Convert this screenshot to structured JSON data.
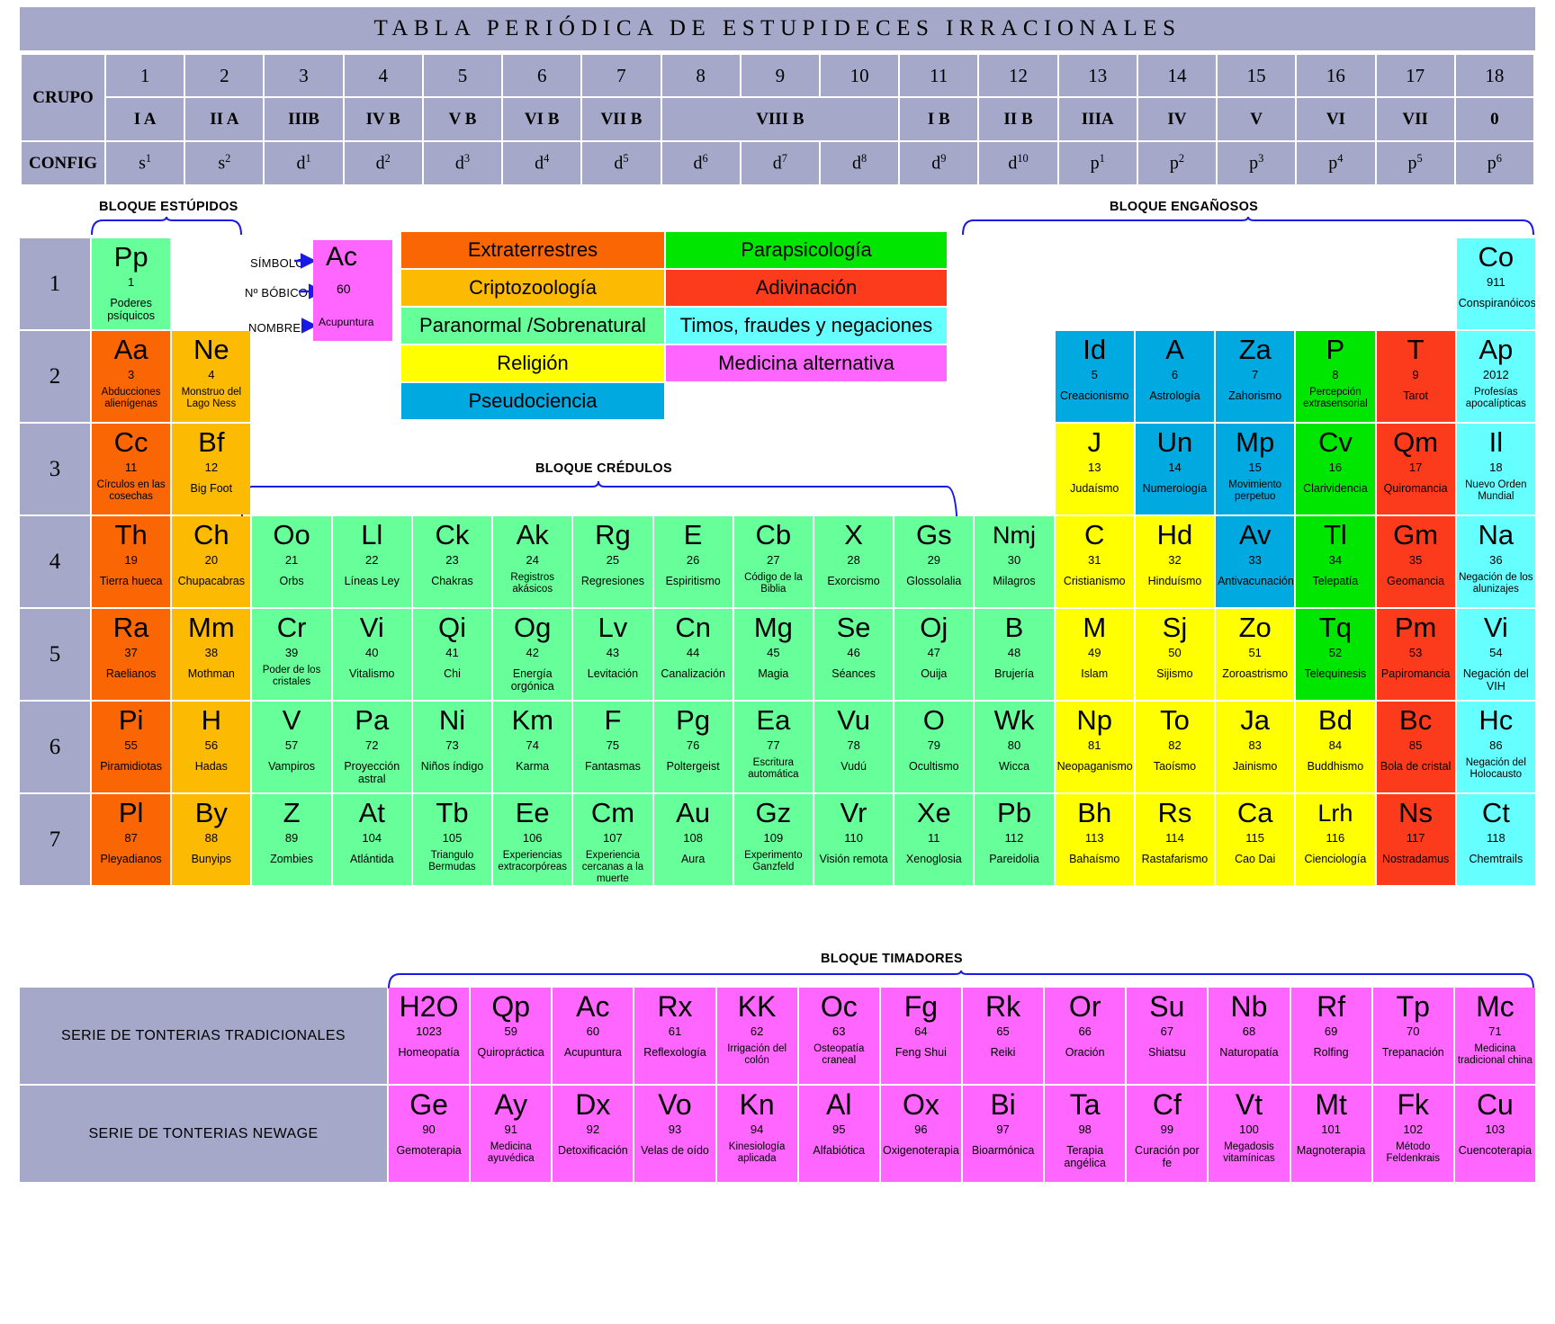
{
  "title": "TABLA  PERIÓDICA  DE  ESTUPIDECES  IRRACIONALES",
  "header": {
    "group_label": "CRUPO",
    "config_label": "CONFIG",
    "numbers": [
      "1",
      "2",
      "3",
      "4",
      "5",
      "6",
      "7",
      "8",
      "9",
      "10",
      "11",
      "12",
      "13",
      "14",
      "15",
      "16",
      "17",
      "18"
    ],
    "roman": [
      "I A",
      "II A",
      "IIIB",
      "IV B",
      "V B",
      "VI B",
      "VII B",
      "VIII B",
      "I B",
      "II B",
      "IIIA",
      "IV",
      "V",
      "VI",
      "VII",
      "0"
    ],
    "config_base": [
      "s",
      "s",
      "d",
      "d",
      "d",
      "d",
      "d",
      "d",
      "d",
      "d",
      "d",
      "d",
      "p",
      "p",
      "p",
      "p",
      "p",
      "p"
    ],
    "config_sup": [
      "1",
      "2",
      "1",
      "2",
      "3",
      "4",
      "5",
      "6",
      "7",
      "8",
      "9",
      "10",
      "1",
      "2",
      "3",
      "4",
      "5",
      "6"
    ]
  },
  "key": {
    "symbol_label": "SÍMBOLO",
    "number_label": "Nº BÓBICO",
    "name_label": "NOMBRE",
    "symbol": "Ac",
    "number": "60",
    "name": "Acupuntura",
    "color": "#ff66ff"
  },
  "legend": [
    {
      "label": "Extraterrestres",
      "color": "#f96603"
    },
    {
      "label": "Parapsicología",
      "color": "#00e600"
    },
    {
      "label": "Criptozoología",
      "color": "#fcba03"
    },
    {
      "label": "Adivinación",
      "color": "#fc3b1c"
    },
    {
      "label": "Paranormal /Sobrenatural",
      "color": "#66ff99"
    },
    {
      "label": "Timos, fraudes y negaciones",
      "color": "#66ffff"
    },
    {
      "label": "Religión",
      "color": "#ffff00"
    },
    {
      "label": "Medicina alternativa",
      "color": "#ff66ff"
    },
    {
      "label": "Pseudociencia",
      "color": "#00a9e0"
    }
  ],
  "blocks": {
    "estupidos": "BLOQUE ESTÚPIDOS",
    "enganosos": "BLOQUE ENGAÑOSOS",
    "credulos": "BLOQUE CRÉDULOS",
    "timadores": "BLOQUE TIMADORES"
  },
  "period_labels": [
    "1",
    "2",
    "3",
    "4",
    "5",
    "6",
    "7"
  ],
  "series_labels": {
    "tradicionales": "SERIE DE TONTERIAS TRADICIONALES",
    "newage": "SERIE DE TONTERIAS NEWAGE"
  },
  "rows": [
    [
      {
        "sym": "Pp",
        "num": "1",
        "name": "Poderes psíquicos",
        "color": "#66ff99"
      },
      null,
      null,
      null,
      null,
      null,
      null,
      null,
      null,
      null,
      null,
      null,
      null,
      null,
      null,
      null,
      null,
      {
        "sym": "Co",
        "num": "911",
        "name": "Conspiranóicos",
        "color": "#66ffff"
      }
    ],
    [
      {
        "sym": "Aa",
        "num": "3",
        "name": "Abducciones alienígenas",
        "color": "#f96603"
      },
      {
        "sym": "Ne",
        "num": "4",
        "name": "Monstruo del Lago Ness",
        "color": "#fcba03"
      },
      null,
      null,
      null,
      null,
      null,
      null,
      null,
      null,
      null,
      null,
      {
        "sym": "Id",
        "num": "5",
        "name": "Creacionismo",
        "color": "#00a9e0"
      },
      {
        "sym": "A",
        "num": "6",
        "name": "Astrología",
        "color": "#00a9e0"
      },
      {
        "sym": "Za",
        "num": "7",
        "name": "Zahorismo",
        "color": "#00a9e0"
      },
      {
        "sym": "P",
        "num": "8",
        "name": "Percepción extrasensorial",
        "color": "#00e600"
      },
      {
        "sym": "T",
        "num": "9",
        "name": "Tarot",
        "color": "#fc3b1c"
      },
      {
        "sym": "Ap",
        "num": "2012",
        "name": "Profesías apocalípticas",
        "color": "#66ffff"
      }
    ],
    [
      {
        "sym": "Cc",
        "num": "11",
        "name": "Círculos en las cosechas",
        "color": "#f96603"
      },
      {
        "sym": "Bf",
        "num": "12",
        "name": "Big Foot",
        "color": "#fcba03"
      },
      null,
      null,
      null,
      null,
      null,
      null,
      null,
      null,
      null,
      null,
      {
        "sym": "J",
        "num": "13",
        "name": "Judaísmo",
        "color": "#ffff00"
      },
      {
        "sym": "Un",
        "num": "14",
        "name": "Numerología",
        "color": "#00a9e0"
      },
      {
        "sym": "Mp",
        "num": "15",
        "name": "Movimiento perpetuo",
        "color": "#00a9e0"
      },
      {
        "sym": "Cv",
        "num": "16",
        "name": "Clarividencia",
        "color": "#00e600"
      },
      {
        "sym": "Qm",
        "num": "17",
        "name": "Quiromancia",
        "color": "#fc3b1c"
      },
      {
        "sym": "Il",
        "num": "18",
        "name": "Nuevo Orden Mundial",
        "color": "#66ffff"
      }
    ],
    [
      {
        "sym": "Th",
        "num": "19",
        "name": "Tierra hueca",
        "color": "#f96603"
      },
      {
        "sym": "Ch",
        "num": "20",
        "name": "Chupacabras",
        "color": "#fcba03"
      },
      {
        "sym": "Oo",
        "num": "21",
        "name": "Orbs",
        "color": "#66ff99"
      },
      {
        "sym": "Ll",
        "num": "22",
        "name": "Líneas Ley",
        "color": "#66ff99"
      },
      {
        "sym": "Ck",
        "num": "23",
        "name": "Chakras",
        "color": "#66ff99"
      },
      {
        "sym": "Ak",
        "num": "24",
        "name": "Registros akásicos",
        "color": "#66ff99"
      },
      {
        "sym": "Rg",
        "num": "25",
        "name": "Regresiones",
        "color": "#66ff99"
      },
      {
        "sym": "E",
        "num": "26",
        "name": "Espiritismo",
        "color": "#66ff99"
      },
      {
        "sym": "Cb",
        "num": "27",
        "name": "Código de la Biblia",
        "color": "#66ff99"
      },
      {
        "sym": "X",
        "num": "28",
        "name": "Exorcismo",
        "color": "#66ff99"
      },
      {
        "sym": "Gs",
        "num": "29",
        "name": "Glossolalia",
        "color": "#66ff99"
      },
      {
        "sym": "Nmj",
        "num": "30",
        "name": "Milagros",
        "color": "#66ff99"
      },
      {
        "sym": "C",
        "num": "31",
        "name": "Cristianismo",
        "color": "#ffff00"
      },
      {
        "sym": "Hd",
        "num": "32",
        "name": "Hinduísmo",
        "color": "#ffff00"
      },
      {
        "sym": "Av",
        "num": "33",
        "name": "Antivacunación",
        "color": "#00a9e0"
      },
      {
        "sym": "Tl",
        "num": "34",
        "name": "Telepatía",
        "color": "#00e600"
      },
      {
        "sym": "Gm",
        "num": "35",
        "name": "Geomancia",
        "color": "#fc3b1c"
      },
      {
        "sym": "Na",
        "num": "36",
        "name": "Negación de los alunizajes",
        "color": "#66ffff"
      }
    ],
    [
      {
        "sym": "Ra",
        "num": "37",
        "name": "Raelianos",
        "color": "#f96603"
      },
      {
        "sym": "Mm",
        "num": "38",
        "name": "Mothman",
        "color": "#fcba03"
      },
      {
        "sym": "Cr",
        "num": "39",
        "name": "Poder de los cristales",
        "color": "#66ff99"
      },
      {
        "sym": "Vi",
        "num": "40",
        "name": "Vitalismo",
        "color": "#66ff99"
      },
      {
        "sym": "Qi",
        "num": "41",
        "name": "Chi",
        "color": "#66ff99"
      },
      {
        "sym": "Og",
        "num": "42",
        "name": "Energía orgónica",
        "color": "#66ff99"
      },
      {
        "sym": "Lv",
        "num": "43",
        "name": "Levitación",
        "color": "#66ff99"
      },
      {
        "sym": "Cn",
        "num": "44",
        "name": "Canalización",
        "color": "#66ff99"
      },
      {
        "sym": "Mg",
        "num": "45",
        "name": "Magia",
        "color": "#66ff99"
      },
      {
        "sym": "Se",
        "num": "46",
        "name": "Séances",
        "color": "#66ff99"
      },
      {
        "sym": "Oj",
        "num": "47",
        "name": "Ouija",
        "color": "#66ff99"
      },
      {
        "sym": "B",
        "num": "48",
        "name": "Brujería",
        "color": "#66ff99"
      },
      {
        "sym": "M",
        "num": "49",
        "name": "Islam",
        "color": "#ffff00"
      },
      {
        "sym": "Sj",
        "num": "50",
        "name": "Sijismo",
        "color": "#ffff00"
      },
      {
        "sym": "Zo",
        "num": "51",
        "name": "Zoroastrismo",
        "color": "#ffff00"
      },
      {
        "sym": "Tq",
        "num": "52",
        "name": "Telequinesis",
        "color": "#00e600"
      },
      {
        "sym": "Pm",
        "num": "53",
        "name": "Papiromancia",
        "color": "#fc3b1c"
      },
      {
        "sym": "Vi",
        "num": "54",
        "name": "Negación del VIH",
        "color": "#66ffff"
      }
    ],
    [
      {
        "sym": "Pi",
        "num": "55",
        "name": "Piramidiotas",
        "color": "#f96603"
      },
      {
        "sym": "H",
        "num": "56",
        "name": "Hadas",
        "color": "#fcba03"
      },
      {
        "sym": "V",
        "num": "57",
        "name": "Vampiros",
        "color": "#66ff99"
      },
      {
        "sym": "Pa",
        "num": "72",
        "name": "Proyección astral",
        "color": "#66ff99"
      },
      {
        "sym": "Ni",
        "num": "73",
        "name": "Niños índigo",
        "color": "#66ff99"
      },
      {
        "sym": "Km",
        "num": "74",
        "name": "Karma",
        "color": "#66ff99"
      },
      {
        "sym": "F",
        "num": "75",
        "name": "Fantasmas",
        "color": "#66ff99"
      },
      {
        "sym": "Pg",
        "num": "76",
        "name": "Poltergeist",
        "color": "#66ff99"
      },
      {
        "sym": "Ea",
        "num": "77",
        "name": "Escritura automática",
        "color": "#66ff99"
      },
      {
        "sym": "Vu",
        "num": "78",
        "name": "Vudú",
        "color": "#66ff99"
      },
      {
        "sym": "O",
        "num": "79",
        "name": "Ocultismo",
        "color": "#66ff99"
      },
      {
        "sym": "Wk",
        "num": "80",
        "name": "Wicca",
        "color": "#66ff99"
      },
      {
        "sym": "Np",
        "num": "81",
        "name": "Neopaganismo",
        "color": "#ffff00"
      },
      {
        "sym": "To",
        "num": "82",
        "name": "Taoísmo",
        "color": "#ffff00"
      },
      {
        "sym": "Ja",
        "num": "83",
        "name": "Jainismo",
        "color": "#ffff00"
      },
      {
        "sym": "Bd",
        "num": "84",
        "name": "Buddhismo",
        "color": "#ffff00"
      },
      {
        "sym": "Bc",
        "num": "85",
        "name": "Bola de cristal",
        "color": "#fc3b1c"
      },
      {
        "sym": "Hc",
        "num": "86",
        "name": "Negación del Holocausto",
        "color": "#66ffff"
      }
    ],
    [
      {
        "sym": "Pl",
        "num": "87",
        "name": "Pleyadianos",
        "color": "#f96603"
      },
      {
        "sym": "By",
        "num": "88",
        "name": "Bunyips",
        "color": "#fcba03"
      },
      {
        "sym": "Z",
        "num": "89",
        "name": "Zombies",
        "color": "#66ff99"
      },
      {
        "sym": "At",
        "num": "104",
        "name": "Atlántida",
        "color": "#66ff99"
      },
      {
        "sym": "Tb",
        "num": "105",
        "name": "Triangulo Bermudas",
        "color": "#66ff99"
      },
      {
        "sym": "Ee",
        "num": "106",
        "name": "Experiencias extracorpóreas",
        "color": "#66ff99"
      },
      {
        "sym": "Cm",
        "num": "107",
        "name": "Experiencia cercanas a la muerte",
        "color": "#66ff99"
      },
      {
        "sym": "Au",
        "num": "108",
        "name": "Aura",
        "color": "#66ff99"
      },
      {
        "sym": "Gz",
        "num": "109",
        "name": "Experimento Ganzfeld",
        "color": "#66ff99"
      },
      {
        "sym": "Vr",
        "num": "110",
        "name": "Visión remota",
        "color": "#66ff99"
      },
      {
        "sym": "Xe",
        "num": "11",
        "name": "Xenoglosia",
        "color": "#66ff99"
      },
      {
        "sym": "Pb",
        "num": "112",
        "name": "Pareidolia",
        "color": "#66ff99"
      },
      {
        "sym": "Bh",
        "num": "113",
        "name": "Bahaísmo",
        "color": "#ffff00"
      },
      {
        "sym": "Rs",
        "num": "114",
        "name": "Rastafarismo",
        "color": "#ffff00"
      },
      {
        "sym": "Ca",
        "num": "115",
        "name": "Cao Dai",
        "color": "#ffff00"
      },
      {
        "sym": "Lrh",
        "num": "116",
        "name": "Cienciología",
        "color": "#ffff00"
      },
      {
        "sym": "Ns",
        "num": "117",
        "name": "Nostradamus",
        "color": "#fc3b1c"
      },
      {
        "sym": "Ct",
        "num": "118",
        "name": "Chemtrails",
        "color": "#66ffff"
      }
    ]
  ],
  "series": {
    "tradicionales": [
      {
        "sym": "H2O",
        "num": "1023",
        "name": "Homeopatía"
      },
      {
        "sym": "Qp",
        "num": "59",
        "name": "Quiropráctica"
      },
      {
        "sym": "Ac",
        "num": "60",
        "name": "Acupuntura"
      },
      {
        "sym": "Rx",
        "num": "61",
        "name": "Reflexología"
      },
      {
        "sym": "KK",
        "num": "62",
        "name": "Irrigación del colón"
      },
      {
        "sym": "Oc",
        "num": "63",
        "name": "Osteopatía craneal"
      },
      {
        "sym": "Fg",
        "num": "64",
        "name": "Feng Shui"
      },
      {
        "sym": "Rk",
        "num": "65",
        "name": "Reiki"
      },
      {
        "sym": "Or",
        "num": "66",
        "name": "Oración"
      },
      {
        "sym": "Su",
        "num": "67",
        "name": "Shiatsu"
      },
      {
        "sym": "Nb",
        "num": "68",
        "name": "Naturopatía"
      },
      {
        "sym": "Rf",
        "num": "69",
        "name": "Rolfing"
      },
      {
        "sym": "Tp",
        "num": "70",
        "name": "Trepanación"
      },
      {
        "sym": "Mc",
        "num": "71",
        "name": "Medicina tradicional china"
      }
    ],
    "newage": [
      {
        "sym": "Ge",
        "num": "90",
        "name": "Gemoterapia"
      },
      {
        "sym": "Ay",
        "num": "91",
        "name": "Medicina ayuvédica"
      },
      {
        "sym": "Dx",
        "num": "92",
        "name": "Detoxificación"
      },
      {
        "sym": "Vo",
        "num": "93",
        "name": "Velas de oído"
      },
      {
        "sym": "Kn",
        "num": "94",
        "name": "Kinesiología aplicada"
      },
      {
        "sym": "Al",
        "num": "95",
        "name": "Alfabiótica"
      },
      {
        "sym": "Ox",
        "num": "96",
        "name": "Oxigenoterapia"
      },
      {
        "sym": "Bi",
        "num": "97",
        "name": "Bioarmónica"
      },
      {
        "sym": "Ta",
        "num": "98",
        "name": "Terapia angélica"
      },
      {
        "sym": "Cf",
        "num": "99",
        "name": "Curación por fe"
      },
      {
        "sym": "Vt",
        "num": "100",
        "name": "Megadosis vitamínicas"
      },
      {
        "sym": "Mt",
        "num": "101",
        "name": "Magnoterapia"
      },
      {
        "sym": "Fk",
        "num": "102",
        "name": "Método Feldenkrais"
      },
      {
        "sym": "Cu",
        "num": "103",
        "name": "Cuencoterapia"
      }
    ]
  }
}
